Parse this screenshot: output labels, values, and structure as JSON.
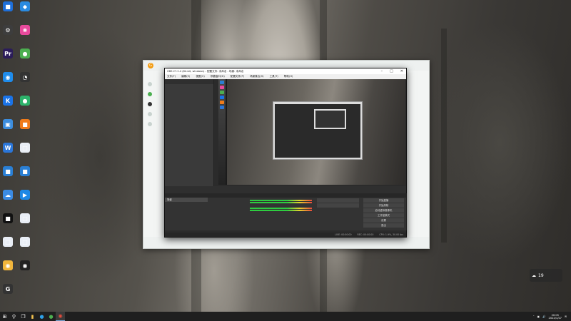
{
  "desktop": {
    "icons": [
      {
        "id": "a",
        "label": "",
        "color": "#1e6fd9",
        "glyph": "■"
      },
      {
        "id": "b",
        "label": "",
        "color": "#2a8be0",
        "glyph": "◆"
      },
      {
        "id": "c",
        "label": "",
        "color": "#3d3d3d",
        "glyph": "⚙"
      },
      {
        "id": "d",
        "label": "",
        "color": "#e84a9c",
        "glyph": "❀"
      },
      {
        "id": "e",
        "label": "",
        "color": "#2b1c5a",
        "glyph": "Pr"
      },
      {
        "id": "f",
        "label": "",
        "color": "#4caf50",
        "glyph": "●"
      },
      {
        "id": "g",
        "label": "",
        "color": "#1f8ceb",
        "glyph": "◉"
      },
      {
        "id": "h",
        "label": "",
        "color": "#333",
        "glyph": "◔"
      },
      {
        "id": "i",
        "label": "",
        "color": "#1a73e8",
        "glyph": "K"
      },
      {
        "id": "j",
        "label": "",
        "color": "#2db36b",
        "glyph": "●"
      },
      {
        "id": "k",
        "label": "",
        "color": "#3c8dde",
        "glyph": "▣"
      },
      {
        "id": "l",
        "label": "",
        "color": "#f07b1a",
        "glyph": "■"
      },
      {
        "id": "m",
        "label": "",
        "color": "#2b76d8",
        "glyph": "W"
      },
      {
        "id": "n",
        "label": "",
        "color": "#e9eef5",
        "glyph": "□"
      },
      {
        "id": "o",
        "label": "",
        "color": "#2a7fd4",
        "glyph": "■"
      },
      {
        "id": "p",
        "label": "",
        "color": "#2a7fd4",
        "glyph": "■"
      },
      {
        "id": "q",
        "label": "",
        "color": "#3b8be3",
        "glyph": "☁"
      },
      {
        "id": "r",
        "label": "",
        "color": "#1e88e5",
        "glyph": "▶"
      },
      {
        "id": "s",
        "label": "",
        "color": "#111",
        "glyph": "■"
      },
      {
        "id": "t",
        "label": "",
        "color": "#e9eef5",
        "glyph": "□"
      },
      {
        "id": "u",
        "label": "",
        "color": "#e9eef5",
        "glyph": "□"
      },
      {
        "id": "v",
        "label": "",
        "color": "#e9eef5",
        "glyph": "□"
      },
      {
        "id": "w",
        "label": "",
        "color": "#f2b63c",
        "glyph": "◉"
      },
      {
        "id": "x",
        "label": "",
        "color": "#222",
        "glyph": "◉"
      },
      {
        "id": "y",
        "label": "",
        "color": "#333",
        "glyph": "G"
      }
    ]
  },
  "app_window": {
    "logo": "G",
    "sidebar_items": [
      "",
      "",
      "",
      "",
      ""
    ],
    "bottom_text": ""
  },
  "obs": {
    "title": "OBS 27.2.4 (64-bit, windows) - 配置文件: 未命名 - 场景: 未命名",
    "menu": [
      "文件(F)",
      "编辑(E)",
      "视图(V)",
      "停靠窗口(D)",
      "配置文件(P)",
      "场景集合(S)",
      "工具(T)",
      "帮助(H)"
    ],
    "left_panel": {
      "heading": "",
      "lines": [
        "",
        "",
        ""
      ]
    },
    "scene_bar_label": "",
    "docks": {
      "scenes": {
        "title": "",
        "items": [
          "场景"
        ]
      },
      "sources": {
        "title": "",
        "items": []
      },
      "mixer": {
        "title": "",
        "channels": [
          "",
          ""
        ]
      },
      "transitions": {
        "title": "",
        "duration": ""
      },
      "controls": {
        "title": "",
        "buttons": [
          "开始直播",
          "开始录制",
          "启动虚拟摄像机",
          "工作室模式",
          "设置",
          "退出"
        ]
      }
    },
    "status": [
      "LIVE: 00:00:00",
      "REC: 00:00:00",
      "CPU: 1.9%, 30.00 fps"
    ]
  },
  "taskbar": {
    "start_icon": "windows-icon",
    "time": "20:05",
    "date": "2022/1/27"
  },
  "weather": {
    "temp": "19"
  }
}
